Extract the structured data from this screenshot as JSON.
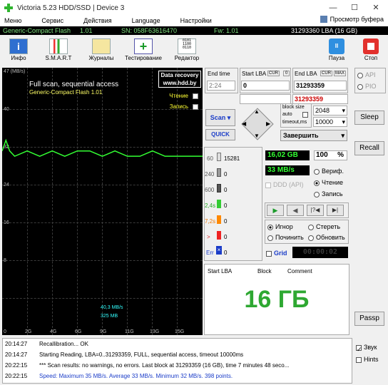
{
  "window": {
    "title": "Victoria 5.23 HDD/SSD | Device 3",
    "min": "—",
    "max": "☐",
    "close": "✕"
  },
  "menu": {
    "items": [
      "Меню",
      "Сервис",
      "Действия",
      "Language",
      "Настройки"
    ],
    "buffer": "Просмотр буфера"
  },
  "infobar": {
    "model": "Generic-Compact Flash",
    "fw_ver": "1.01",
    "sn": "SN: 058F63616470",
    "fw": "Fw: 1.01",
    "lba": "31293360 LBA (16 GB)"
  },
  "toolbar": {
    "info": "Инфо",
    "smart": "S.M.A.R.T",
    "logs": "Журналы",
    "test": "Тестирование",
    "editor": "Редактор",
    "pause": "Пауза",
    "stop": "Стоп"
  },
  "graph": {
    "title": "Full scan, sequential access",
    "subtitle": "Generic-Compact Flash   1.01",
    "watermark_1": "Data recovery",
    "watermark_2": "www.hdd.by",
    "read": "Чтение",
    "write": "Запись",
    "speed_avg": "40,3 MB/s",
    "speed_cur": "325 MB",
    "y_labels": [
      "47 (MB/s)",
      "40",
      "32",
      "24",
      "16",
      "8"
    ],
    "x_labels": [
      "0",
      "2G",
      "4G",
      "6G",
      "9G",
      "11G",
      "13G",
      "15G"
    ]
  },
  "chart_data": {
    "type": "line",
    "title": "Full scan, sequential access",
    "ylabel": "MB/s",
    "ylim": [
      0,
      47
    ],
    "xlim": [
      0,
      16
    ],
    "x": [
      0,
      0.3,
      0.6,
      1,
      2,
      3,
      4,
      5,
      6,
      7,
      8,
      9,
      10,
      11,
      12,
      13,
      14,
      15,
      16
    ],
    "series": [
      {
        "name": "Чтение",
        "values": [
          32,
          34,
          32,
          31,
          32,
          31,
          32,
          31,
          32,
          32,
          31,
          32,
          31,
          31,
          32,
          31,
          31,
          31,
          31
        ]
      }
    ]
  },
  "controls": {
    "end_time": "End time",
    "time_val": "2:24",
    "start_lba": "Start LBA",
    "cur": "CUR",
    "zero": "0",
    "start_val": "0",
    "end_lba": "End LBA",
    "max": "MAX",
    "end_val": "31293359",
    "end_val2": "31293359",
    "block_size": "block size",
    "auto": "auto",
    "block_val": "2048",
    "timeout": "timeout,ms",
    "timeout_val": "10000",
    "scan": "Scan",
    "quick": "QUICK",
    "finish": "Завершить",
    "api": "API",
    "pio": "PIO",
    "sleep": "Sleep",
    "recall": "Recall",
    "passp": "Passp"
  },
  "stats": {
    "r60": "60",
    "c60": "15281",
    "r240": "240",
    "c240": "0",
    "r600": "600",
    "c600": "0",
    "r24": "2,4s",
    "c24": "0",
    "r72": "7,2s",
    "c72": "0",
    "rgt": ">",
    "cgt": "0",
    "rerr": "Err",
    "cerr": "0",
    "size": "16,02 GB",
    "pct": "100",
    "pct_sign": "%",
    "speed": "33 MB/s",
    "ddd": "DDD (API)",
    "verif": "Вериф.",
    "read": "Чтение",
    "write": "Запись",
    "ignore": "Игнор",
    "erase": "Стереть",
    "repair": "Починить",
    "refresh": "Обновить",
    "grid": "Grid",
    "timer": "00:00:02"
  },
  "table": {
    "col1": "Start LBA",
    "col2": "Block",
    "col3": "Comment",
    "big": "16 ГБ"
  },
  "log": [
    {
      "t": "20:14:27",
      "m": "Recallibration... OK",
      "c": "#000"
    },
    {
      "t": "20:14:27",
      "m": "Starting Reading, LBA=0..31293359, FULL, sequential access, timeout 10000ms",
      "c": "#000"
    },
    {
      "t": "20:22:15",
      "m": "*** Scan results: no warnings, no errors. Last block at 31293359 (16 GB), time 7 minutes 48 seco...",
      "c": "#000"
    },
    {
      "t": "20:22:15",
      "m": "Speed: Maximum 35 MB/s. Average 33 MB/s. Minimum 32 MB/s. 398 points.",
      "c": "#1a3cc8"
    }
  ],
  "side": {
    "sound": "Звук",
    "hints": "Hints"
  },
  "colors": {
    "accent": "#33ff33",
    "big_text": "#2ea832",
    "log_blue": "#1a3cc8"
  }
}
